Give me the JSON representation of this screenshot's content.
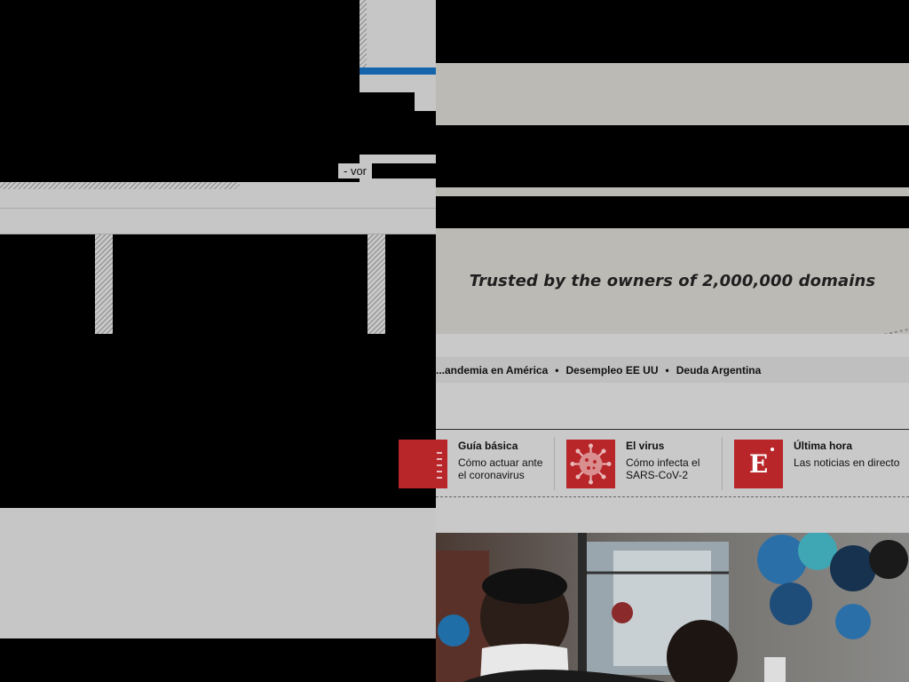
{
  "left_pane": {
    "vor_label": "- vor"
  },
  "right_pane": {
    "trusted_text": "Trusted by the owners of 2,000,000 domains",
    "topics": [
      "...andemia en América",
      "Desempleo EE UU",
      "Deuda Argentina"
    ],
    "topic_separator": "•",
    "cards": [
      {
        "title": "Guía básica",
        "desc_lines": [
          "Cómo actuar ante",
          "el coronavirus"
        ],
        "icon": "guide-icon"
      },
      {
        "title": "El virus",
        "desc_lines": [
          "Cómo infecta el",
          "SARS-CoV-2"
        ],
        "icon": "virus-icon"
      },
      {
        "title": "Última hora",
        "desc_lines": [
          "Las noticias en directo"
        ],
        "icon": "el-pais-logo-icon",
        "icon_letter": "E"
      }
    ],
    "photo_alt": "Person wearing a face mask near balloons"
  },
  "colors": {
    "accent_blue": "#1565ad",
    "card_red": "#b8262a",
    "banner_gray": "#bcbab5"
  }
}
